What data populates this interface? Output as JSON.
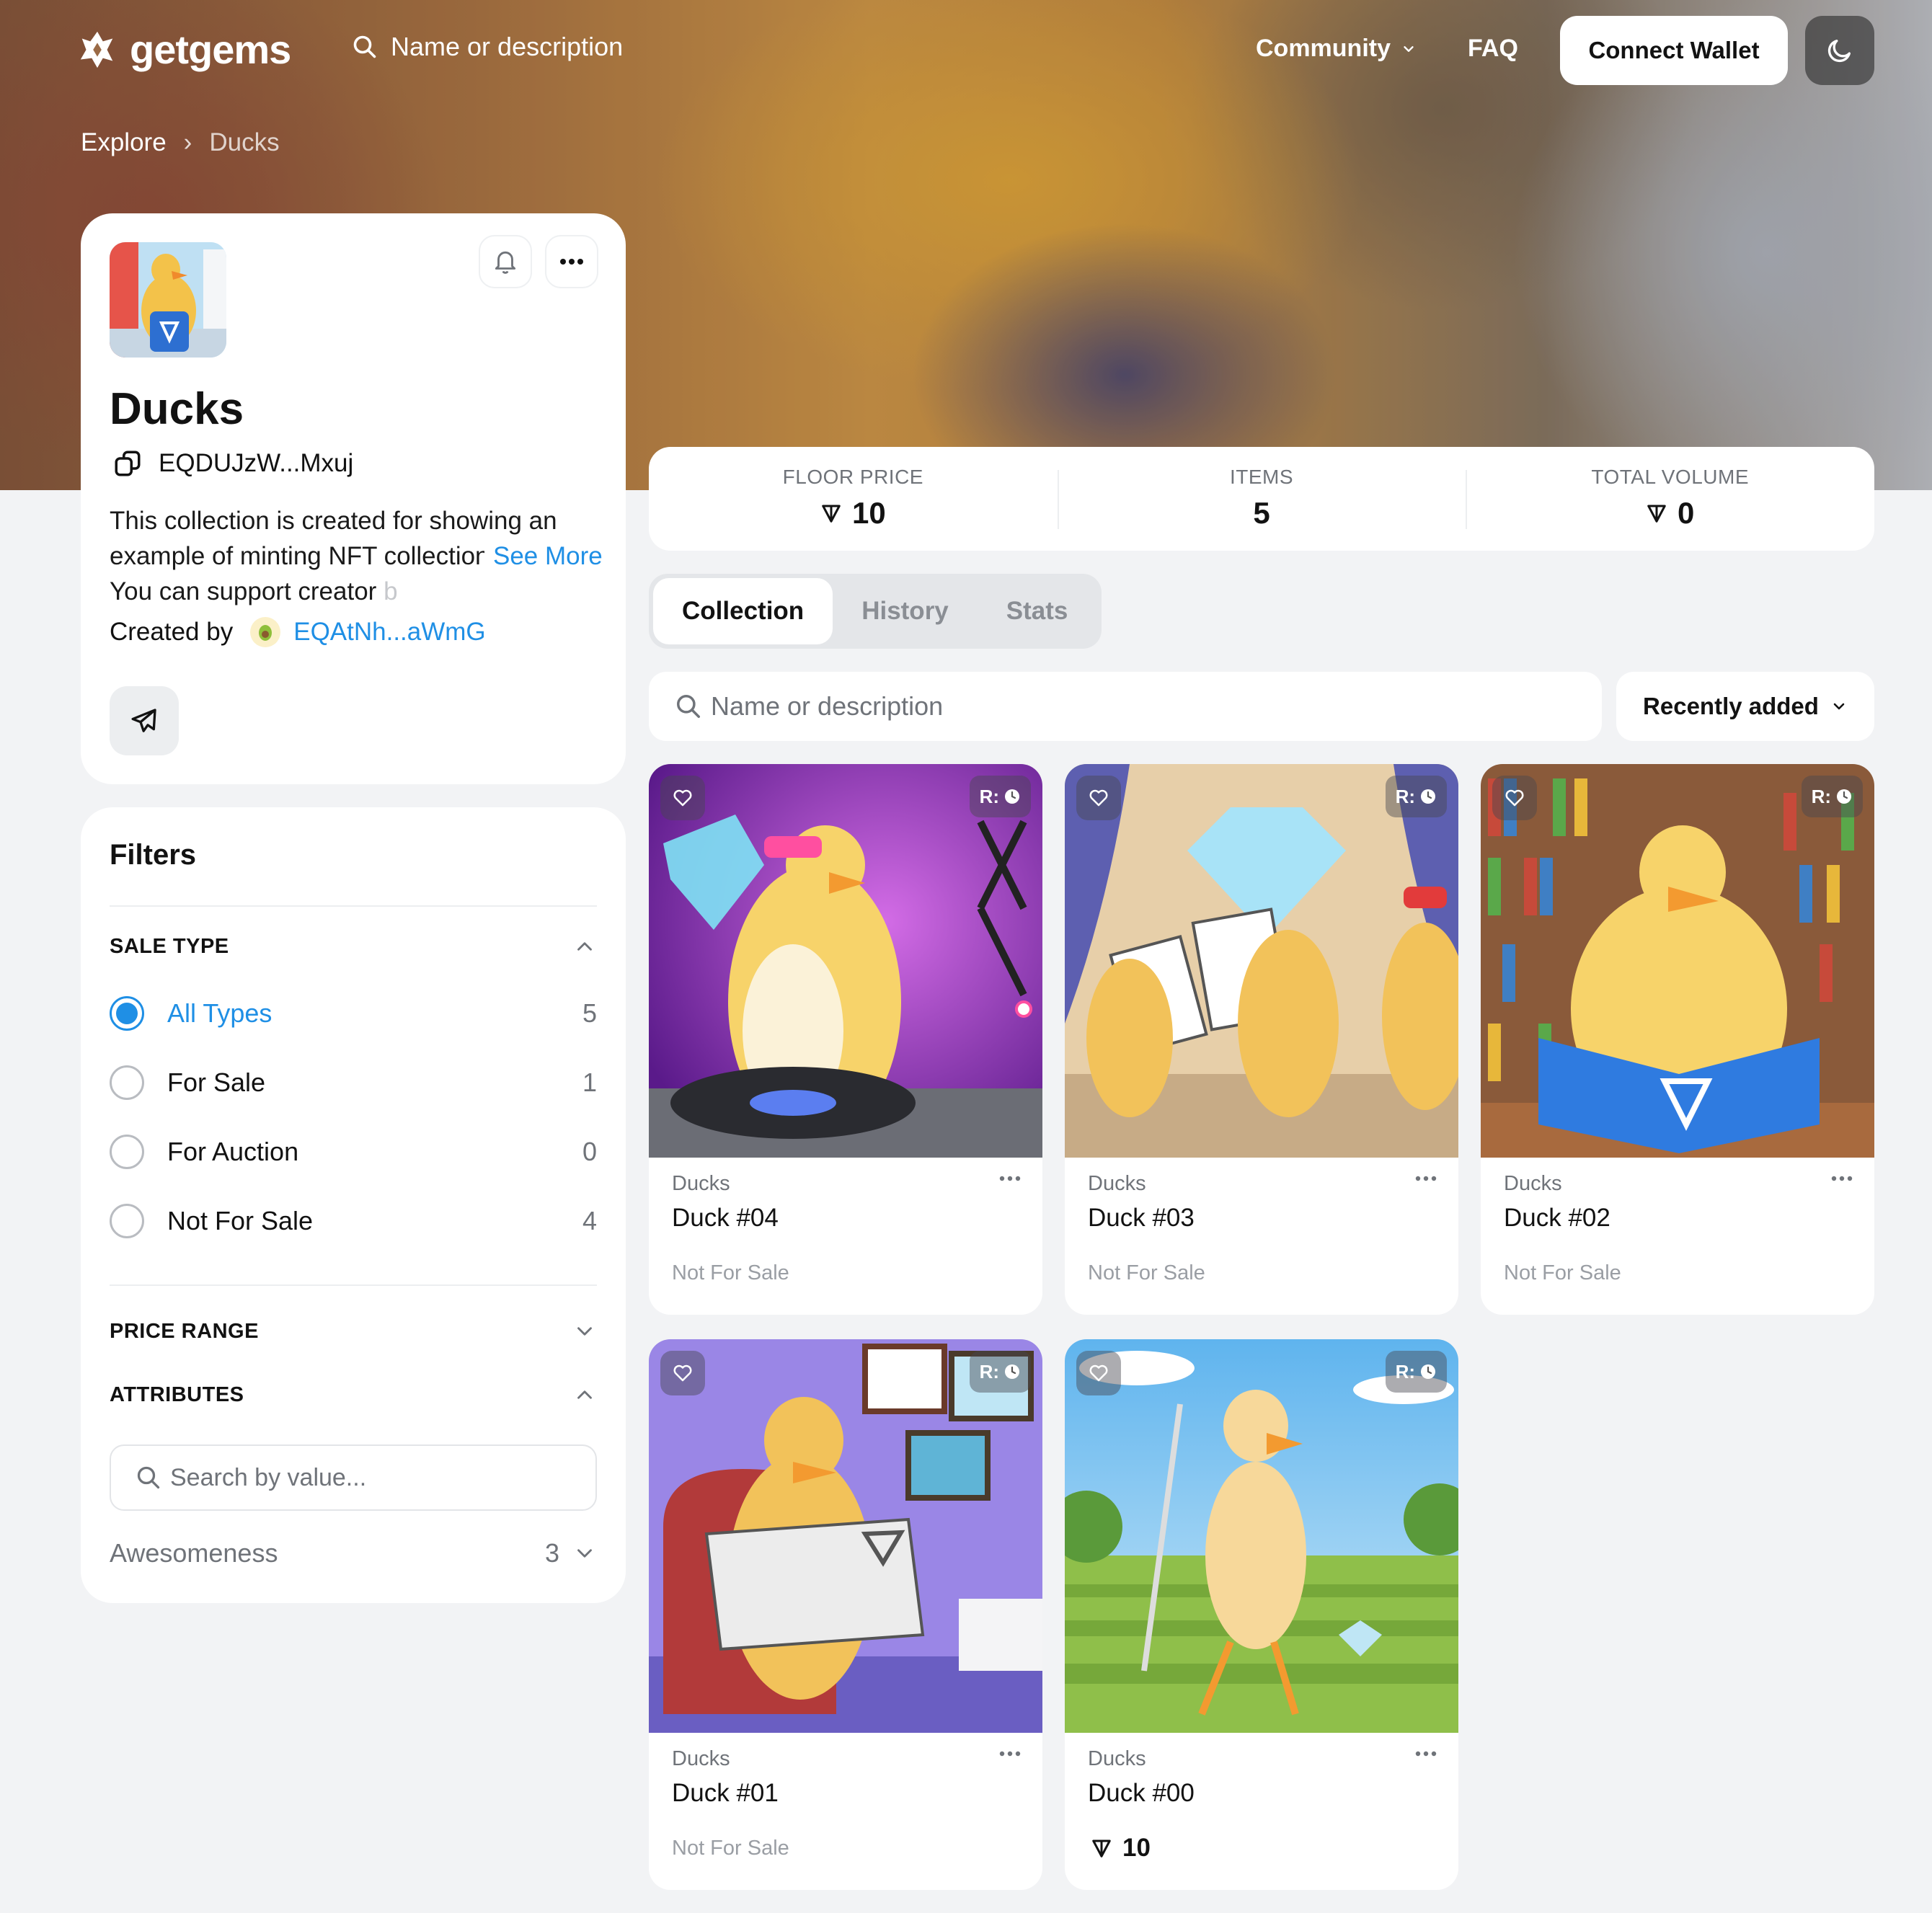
{
  "brand": {
    "name": "getgems"
  },
  "nav": {
    "search_placeholder": "Name or description",
    "community": "Community",
    "faq": "FAQ",
    "connect": "Connect Wallet"
  },
  "breadcrumb": {
    "root": "Explore",
    "current": "Ducks"
  },
  "collection": {
    "title": "Ducks",
    "address": "EQDUJzW...Mxuj",
    "description": "This collection is created for showing an example of minting NFT collection on TON. You can support creator ",
    "description_fade": "b",
    "see_more": "See More",
    "created_by_label": "Created by",
    "creator": "EQAtNh...aWmG"
  },
  "filters": {
    "title": "Filters",
    "sale_type": {
      "title": "SALE TYPE",
      "options": [
        {
          "label": "All Types",
          "count": "5"
        },
        {
          "label": "For Sale",
          "count": "1"
        },
        {
          "label": "For Auction",
          "count": "0"
        },
        {
          "label": "Not For Sale",
          "count": "4"
        }
      ]
    },
    "price_range": "PRICE RANGE",
    "attributes": {
      "title": "ATTRIBUTES",
      "search_placeholder": "Search by value...",
      "items": [
        {
          "label": "Awesomeness",
          "count": "3"
        }
      ]
    }
  },
  "stats": [
    {
      "label": "FLOOR PRICE",
      "value": "10"
    },
    {
      "label": "ITEMS",
      "value": "5"
    },
    {
      "label": "TOTAL VOLUME",
      "value": "0"
    }
  ],
  "tabs": [
    "Collection",
    "History",
    "Stats"
  ],
  "grid": {
    "search_placeholder": "Name or description",
    "sort": "Recently added",
    "rarity_label": "R:",
    "items": [
      {
        "collection": "Ducks",
        "name": "Duck #04",
        "status": "Not For Sale"
      },
      {
        "collection": "Ducks",
        "name": "Duck #03",
        "status": "Not For Sale"
      },
      {
        "collection": "Ducks",
        "name": "Duck #02",
        "status": "Not For Sale"
      },
      {
        "collection": "Ducks",
        "name": "Duck #01",
        "status": "Not For Sale"
      },
      {
        "collection": "Ducks",
        "name": "Duck #00",
        "price": "10"
      }
    ]
  },
  "colors": {
    "accent": "#1f8fe5",
    "background": "#f2f3f5"
  },
  "icons": [
    "getgems-logo-icon",
    "search-icon",
    "chevron-down-icon",
    "moon-icon",
    "bell-icon",
    "more-icon",
    "copy-icon",
    "telegram-icon",
    "ton-icon",
    "heart-icon",
    "clock-icon",
    "chevron-up-icon"
  ]
}
